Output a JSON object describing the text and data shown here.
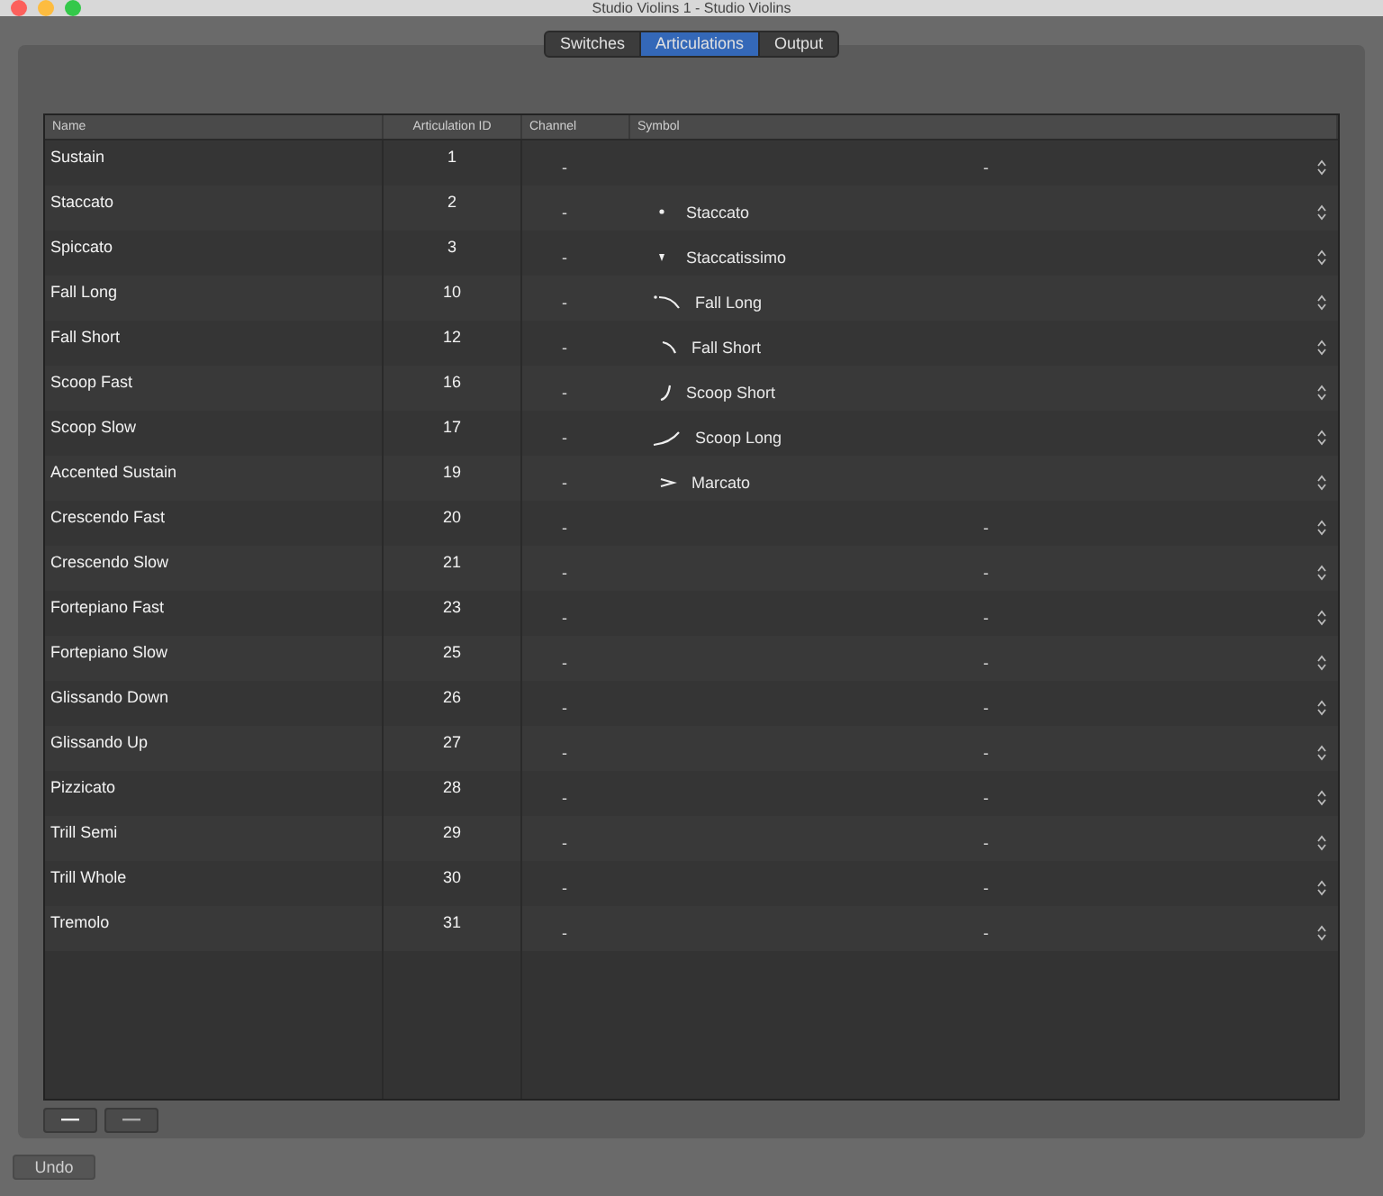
{
  "window": {
    "title": "Studio Violins 1 - Studio Violins"
  },
  "tabs": [
    {
      "label": "Switches",
      "selected": false
    },
    {
      "label": "Articulations",
      "selected": true
    },
    {
      "label": "Output",
      "selected": false
    }
  ],
  "table": {
    "columns": [
      "Name",
      "Articulation ID",
      "Channel",
      "Symbol"
    ],
    "rows": [
      {
        "name": "Sustain",
        "id": "1",
        "channel": "-",
        "symbol": {
          "kind": "none",
          "label": "-"
        }
      },
      {
        "name": "Staccato",
        "id": "2",
        "channel": "-",
        "symbol": {
          "kind": "staccato",
          "label": "Staccato"
        }
      },
      {
        "name": "Spiccato",
        "id": "3",
        "channel": "-",
        "symbol": {
          "kind": "staccatissimo",
          "label": "Staccatissimo"
        }
      },
      {
        "name": "Fall Long",
        "id": "10",
        "channel": "-",
        "symbol": {
          "kind": "fall-long",
          "label": "Fall Long"
        }
      },
      {
        "name": "Fall Short",
        "id": "12",
        "channel": "-",
        "symbol": {
          "kind": "fall-short",
          "label": "Fall Short"
        }
      },
      {
        "name": "Scoop Fast",
        "id": "16",
        "channel": "-",
        "symbol": {
          "kind": "scoop-short",
          "label": "Scoop Short"
        }
      },
      {
        "name": "Scoop Slow",
        "id": "17",
        "channel": "-",
        "symbol": {
          "kind": "scoop-long",
          "label": "Scoop Long"
        }
      },
      {
        "name": "Accented Sustain",
        "id": "19",
        "channel": "-",
        "symbol": {
          "kind": "marcato",
          "label": "Marcato"
        }
      },
      {
        "name": "Crescendo Fast",
        "id": "20",
        "channel": "-",
        "symbol": {
          "kind": "none",
          "label": "-"
        }
      },
      {
        "name": "Crescendo Slow",
        "id": "21",
        "channel": "-",
        "symbol": {
          "kind": "none",
          "label": "-"
        }
      },
      {
        "name": "Fortepiano Fast",
        "id": "23",
        "channel": "-",
        "symbol": {
          "kind": "none",
          "label": "-"
        }
      },
      {
        "name": "Fortepiano Slow",
        "id": "25",
        "channel": "-",
        "symbol": {
          "kind": "none",
          "label": "-"
        }
      },
      {
        "name": "Glissando Down",
        "id": "26",
        "channel": "-",
        "symbol": {
          "kind": "none",
          "label": "-"
        }
      },
      {
        "name": "Glissando Up",
        "id": "27",
        "channel": "-",
        "symbol": {
          "kind": "none",
          "label": "-"
        }
      },
      {
        "name": "Pizzicato",
        "id": "28",
        "channel": "-",
        "symbol": {
          "kind": "none",
          "label": "-"
        }
      },
      {
        "name": "Trill Semi",
        "id": "29",
        "channel": "-",
        "symbol": {
          "kind": "none",
          "label": "-"
        }
      },
      {
        "name": "Trill Whole",
        "id": "30",
        "channel": "-",
        "symbol": {
          "kind": "none",
          "label": "-"
        }
      },
      {
        "name": "Tremolo",
        "id": "31",
        "channel": "-",
        "symbol": {
          "kind": "none",
          "label": "-"
        }
      }
    ]
  },
  "undo_button": "Undo"
}
